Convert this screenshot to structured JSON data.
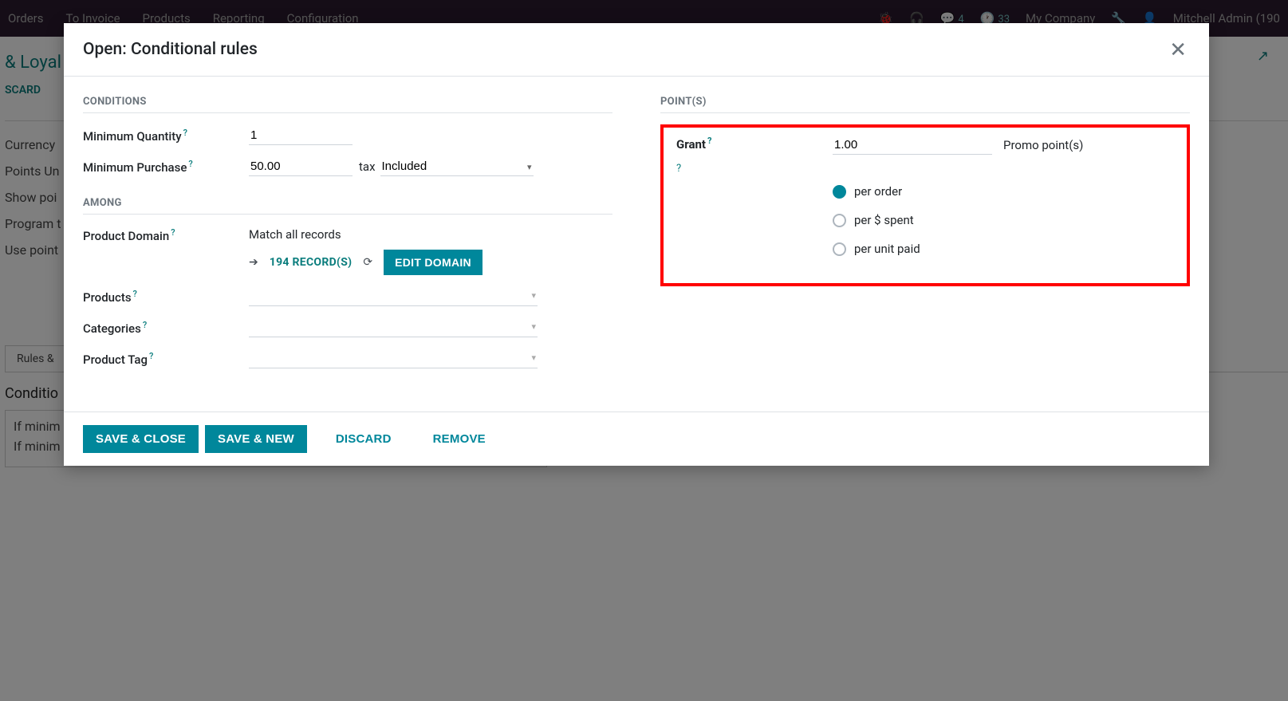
{
  "bg": {
    "nav": {
      "orders": "Orders",
      "to_invoice": "To Invoice",
      "products": "Products",
      "reporting": "Reporting",
      "configuration": "Configuration"
    },
    "msg_badge": "4",
    "clock_badge": "33",
    "company": "My Company",
    "user": "Mitchell Admin (190",
    "title": "& Loyal",
    "discard": "SCARD",
    "rows": {
      "currency": "Currency",
      "points_unit": "Points Un",
      "show_points": "Show poi",
      "program": "Program t",
      "use_points": "Use point"
    },
    "tab": "Rules &",
    "cond_title": "Conditio",
    "cond_line1": "If minim",
    "cond_line2": "If minim"
  },
  "modal": {
    "title": "Open: Conditional rules",
    "sections": {
      "conditions": "CONDITIONS",
      "among": "AMONG",
      "points": "POINT(S)"
    },
    "fields": {
      "min_qty_label": "Minimum Quantity",
      "min_qty_value": "1",
      "min_purchase_label": "Minimum Purchase",
      "min_purchase_value": "50.00",
      "tax_label": "tax",
      "tax_value": "Included",
      "product_domain_label": "Product Domain",
      "match_prefix": "Match ",
      "match_bold": "all records",
      "records_link": "194 RECORD(S)",
      "edit_domain": "EDIT DOMAIN",
      "products_label": "Products",
      "categories_label": "Categories",
      "product_tag_label": "Product Tag"
    },
    "grant": {
      "label": "Grant",
      "value": "1.00",
      "unit": "Promo point(s)",
      "options": {
        "per_order": "per order",
        "per_spent": "per $ spent",
        "per_unit": "per unit paid"
      }
    },
    "footer": {
      "save_close": "SAVE & CLOSE",
      "save_new": "SAVE & NEW",
      "discard": "DISCARD",
      "remove": "REMOVE"
    }
  }
}
